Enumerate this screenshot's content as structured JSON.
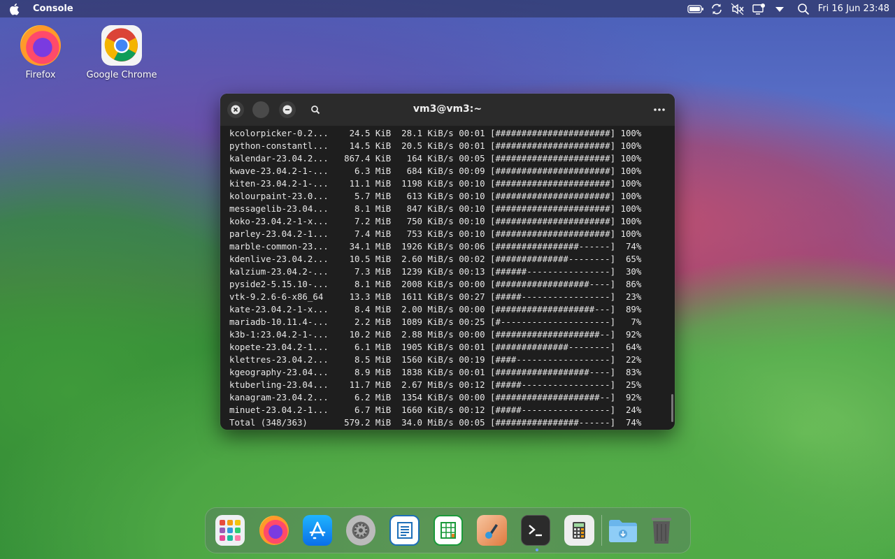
{
  "menubar": {
    "app_name": "Console",
    "clock": "Fri 16 Jun 23:48",
    "icons": [
      "apple-logo",
      "battery-icon",
      "refresh-icon",
      "volume-muted-icon",
      "display-icon",
      "dropdown-arrow-icon",
      "search-icon"
    ]
  },
  "desktop": {
    "icons": [
      {
        "label": "Firefox",
        "icon": "firefox-icon"
      },
      {
        "label": "Google Chrome",
        "icon": "chrome-icon"
      }
    ]
  },
  "terminal": {
    "title": "vm3@vm3:~",
    "lines": [
      "kcolorpicker-0.2...    24.5 KiB  28.1 KiB/s 00:01 [######################] 100%",
      "python-constantl...    14.5 KiB  20.5 KiB/s 00:01 [######################] 100%",
      "kalendar-23.04.2...   867.4 KiB   164 KiB/s 00:05 [######################] 100%",
      "kwave-23.04.2-1-...     6.3 MiB   684 KiB/s 00:09 [######################] 100%",
      "kiten-23.04.2-1-...    11.1 MiB  1198 KiB/s 00:10 [######################] 100%",
      "kolourpaint-23.0...     5.7 MiB   613 KiB/s 00:10 [######################] 100%",
      "messagelib-23.04...     8.1 MiB   847 KiB/s 00:10 [######################] 100%",
      "koko-23.04.2-1-x...     7.2 MiB   750 KiB/s 00:10 [######################] 100%",
      "parley-23.04.2-1...     7.4 MiB   753 KiB/s 00:10 [######################] 100%",
      "marble-common-23...    34.1 MiB  1926 KiB/s 00:06 [################------]  74%",
      "kdenlive-23.04.2...    10.5 MiB  2.60 MiB/s 00:02 [##############--------]  65%",
      "kalzium-23.04.2-...     7.3 MiB  1239 KiB/s 00:13 [######----------------]  30%",
      "pyside2-5.15.10-...     8.1 MiB  2008 KiB/s 00:00 [##################----]  86%",
      "vtk-9.2.6-6-x86_64     13.3 MiB  1611 KiB/s 00:27 [#####-----------------]  23%",
      "kate-23.04.2-1-x...     8.4 MiB  2.00 MiB/s 00:00 [###################---]  89%",
      "mariadb-10.11.4-...     2.2 MiB  1089 KiB/s 00:25 [#---------------------]   7%",
      "k3b-1:23.04.2-1-...    10.2 MiB  2.88 MiB/s 00:00 [####################--]  92%",
      "kopete-23.04.2-1...     6.1 MiB  1905 KiB/s 00:01 [##############--------]  64%",
      "klettres-23.04.2...     8.5 MiB  1560 KiB/s 00:19 [####------------------]  22%",
      "kgeography-23.04...     8.9 MiB  1838 KiB/s 00:01 [##################----]  83%",
      "ktuberling-23.04...    11.7 MiB  2.67 MiB/s 00:12 [#####-----------------]  25%",
      "kanagram-23.04.2...     6.2 MiB  1354 KiB/s 00:00 [####################--]  92%",
      "minuet-23.04.2-1...     6.7 MiB  1660 KiB/s 00:12 [#####-----------------]  24%",
      "Total (348/363)       579.2 MiB  34.0 MiB/s 00:05 [################------]  74%"
    ]
  },
  "dock": {
    "items": [
      {
        "name": "launcher",
        "icon": "app-grid-icon"
      },
      {
        "name": "firefox",
        "icon": "firefox-icon"
      },
      {
        "name": "app-store",
        "icon": "app-store-icon"
      },
      {
        "name": "system-settings",
        "icon": "settings-icon"
      },
      {
        "name": "writer",
        "icon": "document-icon"
      },
      {
        "name": "calc",
        "icon": "spreadsheet-icon"
      },
      {
        "name": "draw",
        "icon": "drawing-icon"
      },
      {
        "name": "terminal",
        "icon": "terminal-icon",
        "running": true
      },
      {
        "name": "calculator",
        "icon": "calculator-icon"
      },
      {
        "name": "downloads",
        "icon": "downloads-folder-icon"
      },
      {
        "name": "trash",
        "icon": "trash-icon"
      }
    ]
  }
}
